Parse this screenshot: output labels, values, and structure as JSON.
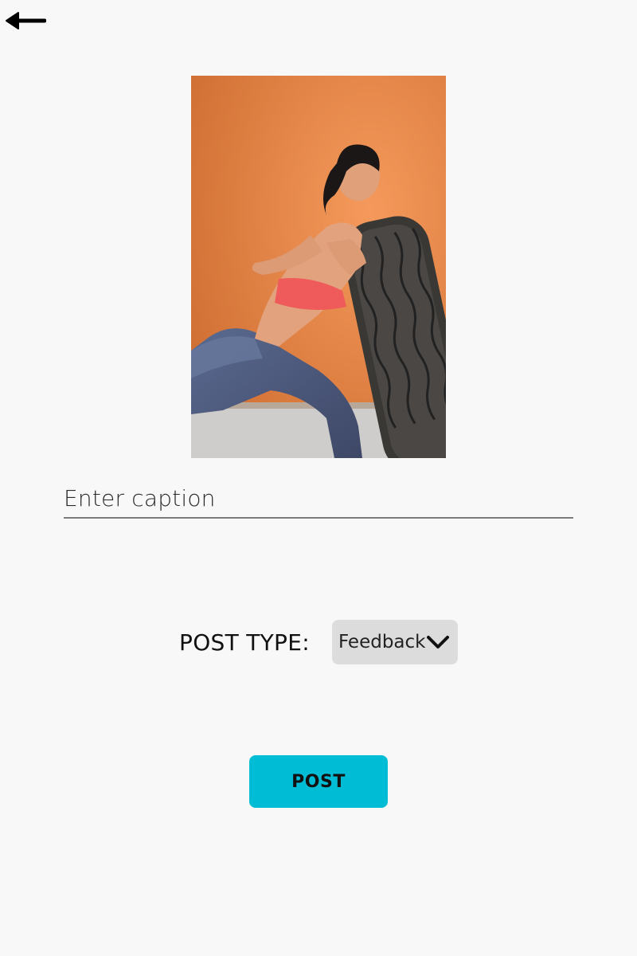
{
  "header": {
    "back_icon": "arrow-left-icon"
  },
  "photo": {
    "subject": "woman pushing a large tire against an orange wall",
    "bg_color": "#e0783a"
  },
  "caption": {
    "placeholder": "Enter caption",
    "value": ""
  },
  "post_type": {
    "label": "POST TYPE:",
    "selected": "Feedback",
    "icon": "chevron-down-icon"
  },
  "actions": {
    "post_label": "POST",
    "post_color": "#00bcd4"
  }
}
